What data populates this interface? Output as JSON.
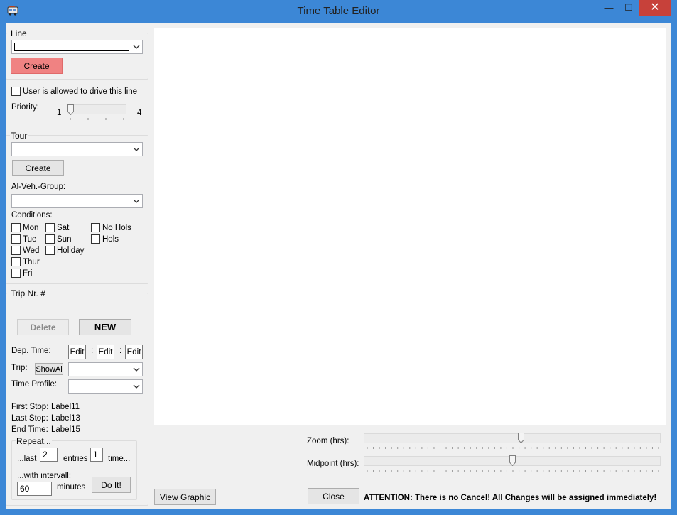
{
  "window": {
    "title": "Time Table Editor",
    "minimize_symbol": "—",
    "maximize_symbol": "☐",
    "close_symbol": "✕",
    "app_icon": "bus-icon"
  },
  "colors": {
    "titlebar": "#3c87d6",
    "close_button": "#c7413a",
    "create_line_button": "#f08282",
    "client": "#f0f0f0"
  },
  "line": {
    "group_label": "Line",
    "combo_value": "",
    "create_label": "Create"
  },
  "permission": {
    "checkbox_label": "User is allowed to drive this line",
    "checked": false
  },
  "priority": {
    "label": "Priority:",
    "min": "1",
    "max": "4",
    "value": 1
  },
  "tour": {
    "group_label": "Tour",
    "combo_value": "",
    "create_label": "Create",
    "vehicle_group_label": "Al-Veh.-Group:",
    "vehicle_group_value": "",
    "conditions_label": "Conditions:",
    "conditions": {
      "mon": "Mon",
      "tue": "Tue",
      "wed": "Wed",
      "thur": "Thur",
      "fri": "Fri",
      "sat": "Sat",
      "sun": "Sun",
      "holiday": "Holiday",
      "no_hols": "No Hols",
      "hols": "Hols"
    }
  },
  "trip": {
    "group_label": "Trip Nr. #",
    "delete_label": "Delete",
    "new_label": "NEW",
    "dep_time_label": "Dep. Time:",
    "edit1": "Edit",
    "edit2": "Edit",
    "edit3": "Edit",
    "colon": ":",
    "trip_label": "Trip:",
    "show_all_label": "ShowAl",
    "trip_value": "",
    "time_profile_label": "Time Profile:",
    "time_profile_value": "",
    "first_stop_label": "First Stop:",
    "first_stop_value": "Label11",
    "last_stop_label": "Last Stop:",
    "last_stop_value": "Label13",
    "end_time_label": "End Time:",
    "end_time_value": "Label15"
  },
  "repeat": {
    "group_label": "Repeat...",
    "last_label": "...last",
    "entries_value": "2",
    "entries_label": "entries",
    "times_value": "1",
    "times_label": "time...",
    "interval_label": "...with intervall:",
    "interval_value": "60",
    "minutes_label": "minutes",
    "do_it_label": "Do It!"
  },
  "bottom": {
    "view_graphic_label": "View Graphic",
    "zoom_label": "Zoom (hrs):",
    "zoom_value": 0.53,
    "midpoint_label": "Midpoint (hrs):",
    "midpoint_value": 0.5,
    "close_label": "Close",
    "attention": "ATTENTION: There is no Cancel! All Changes will be assigned immediately!"
  }
}
